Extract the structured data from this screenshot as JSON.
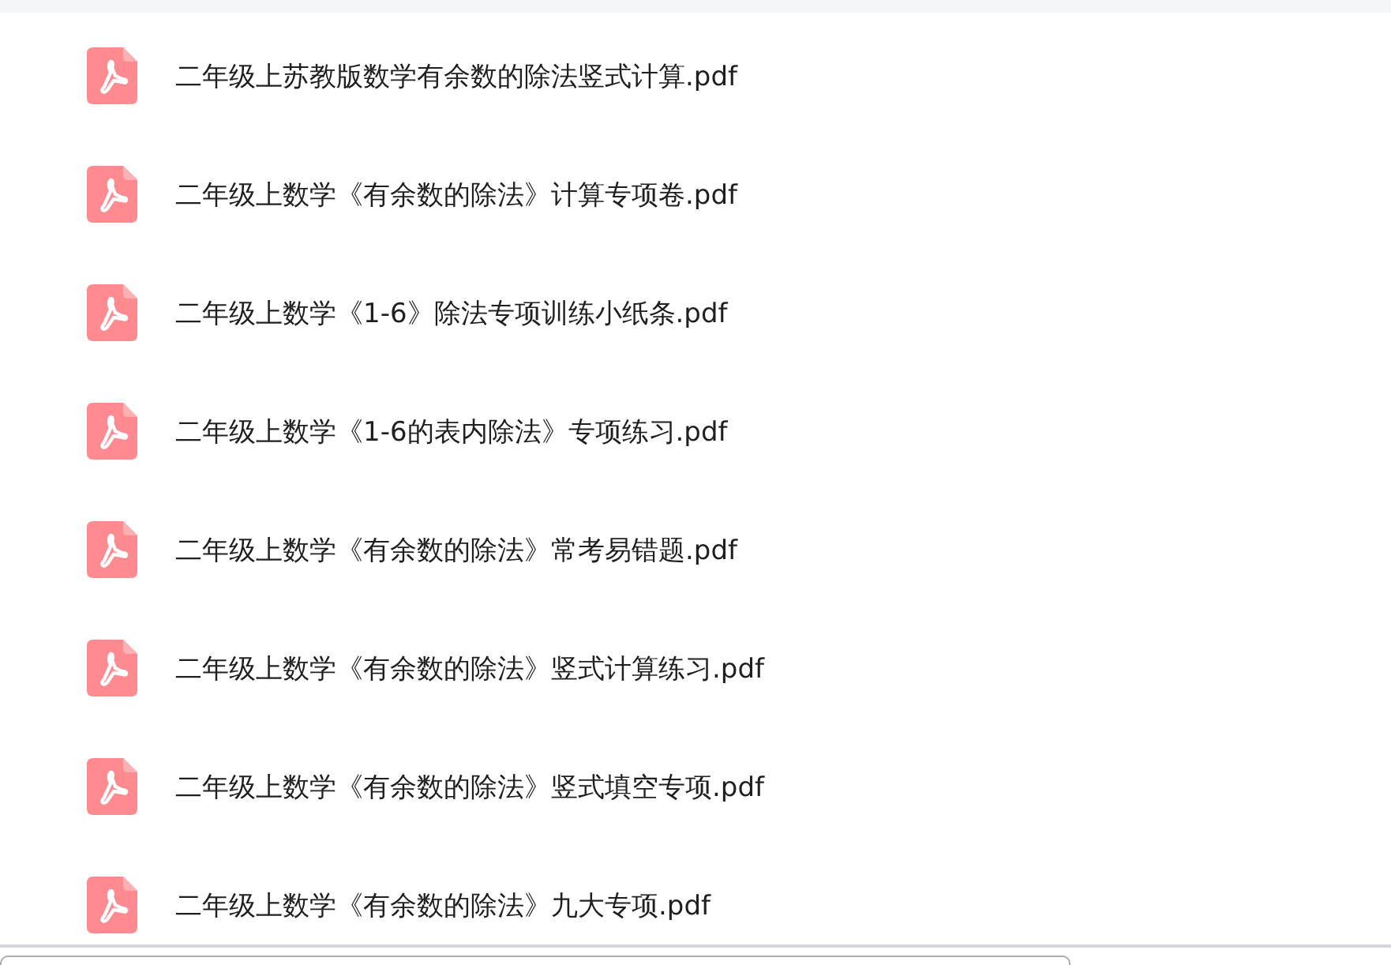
{
  "files": [
    {
      "name": "二年级上苏教版数学有余数的除法竖式计算.pdf"
    },
    {
      "name": "二年级上数学《有余数的除法》计算专项卷.pdf"
    },
    {
      "name": "二年级上数学《1-6》除法专项训练小纸条.pdf"
    },
    {
      "name": "二年级上数学《1-6的表内除法》专项练习.pdf"
    },
    {
      "name": "二年级上数学《有余数的除法》常考易错题.pdf"
    },
    {
      "name": "二年级上数学《有余数的除法》竖式计算练习.pdf"
    },
    {
      "name": "二年级上数学《有余数的除法》竖式填空专项.pdf"
    },
    {
      "name": "二年级上数学《有余数的除法》九大专项.pdf"
    }
  ]
}
